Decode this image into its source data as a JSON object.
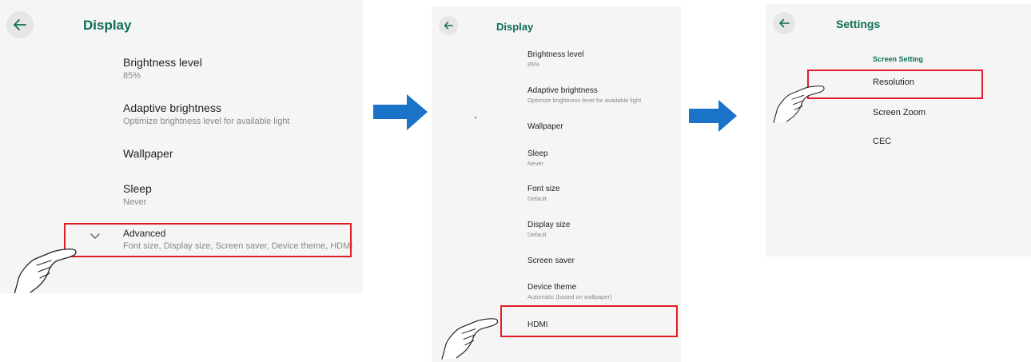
{
  "panel1": {
    "title": "Display",
    "items": [
      {
        "title": "Brightness level",
        "subtitle": "85%"
      },
      {
        "title": "Adaptive brightness",
        "subtitle": "Optimize brightness level for available light"
      },
      {
        "title": "Wallpaper",
        "subtitle": ""
      },
      {
        "title": "Sleep",
        "subtitle": "Never"
      },
      {
        "title": "Advanced",
        "subtitle": "Font size, Display size, Screen saver, Device theme, HDMI"
      }
    ]
  },
  "panel2": {
    "title": "Display",
    "items": [
      {
        "title": "Brightness level",
        "subtitle": "85%"
      },
      {
        "title": "Adaptive brightness",
        "subtitle": "Optimize brightness level for available light"
      },
      {
        "title": "Wallpaper",
        "subtitle": ""
      },
      {
        "title": "Sleep",
        "subtitle": "Never"
      },
      {
        "title": "Font size",
        "subtitle": "Default"
      },
      {
        "title": "Display size",
        "subtitle": "Default"
      },
      {
        "title": "Screen saver",
        "subtitle": ""
      },
      {
        "title": "Device theme",
        "subtitle": "Automatic (based on wallpaper)"
      },
      {
        "title": "HDMI",
        "subtitle": ""
      }
    ]
  },
  "panel3": {
    "title": "Settings",
    "section": "Screen Setting",
    "items": [
      {
        "title": "Resolution"
      },
      {
        "title": "Screen Zoom"
      },
      {
        "title": "CEC"
      }
    ]
  },
  "icons": {
    "back": "arrow-left-icon",
    "expand": "chevron-down-icon",
    "pointer": "hand-pointer-icon",
    "step": "arrow-right-icon"
  },
  "colors": {
    "accent": "#0f6e58",
    "highlight": "#e01e26",
    "step_arrow": "#1a73c8",
    "background": "#f5f5f5"
  }
}
